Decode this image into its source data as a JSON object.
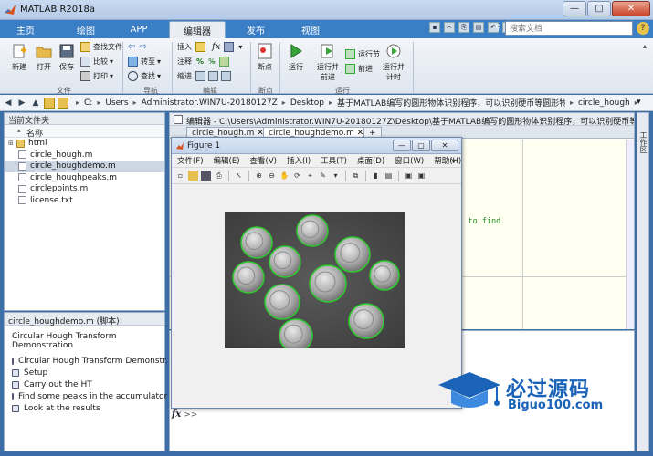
{
  "window": {
    "title": "MATLAB R2018a",
    "buttons": {
      "minimize": "—",
      "maximize": "▢",
      "close": "✕"
    }
  },
  "tabs": [
    {
      "label": "主页"
    },
    {
      "label": "绘图"
    },
    {
      "label": "APP"
    },
    {
      "label": "编辑器",
      "active": true
    },
    {
      "label": "发布"
    },
    {
      "label": "视图"
    }
  ],
  "search": {
    "placeholder": "搜索文档"
  },
  "ribbon": {
    "file": {
      "new": "新建",
      "open": "打开",
      "save": "保存",
      "find_files": "查找文件",
      "compare": "比较",
      "print": "打印",
      "group": "文件"
    },
    "navigate": {
      "goto": "转至",
      "find": "查找",
      "group": "导航"
    },
    "edit": {
      "insert": "插入",
      "comment": "注释",
      "indent": "缩进",
      "fx": "fx",
      "group": "编辑"
    },
    "breakpoints": {
      "breakpoints": "断点",
      "group": "断点"
    },
    "run": {
      "run": "运行",
      "run_advance": "运行并\n前进",
      "run_section": "运行节",
      "advance": "前进",
      "run_time": "运行并\n计时",
      "group": "运行"
    }
  },
  "address": {
    "segments": [
      "C:",
      "Users",
      "Administrator.WIN7U-20180127Z",
      "Desktop",
      "基于MATLAB编写的圆形物体识别程序，可以识别硬币等圆形物体",
      "circle_hough"
    ]
  },
  "current_folder": {
    "title": "当前文件夹",
    "column": "名称",
    "files": [
      {
        "name": "html",
        "type": "folder"
      },
      {
        "name": "circle_hough.m",
        "type": "m"
      },
      {
        "name": "circle_houghdemo.m",
        "type": "m",
        "selected": true
      },
      {
        "name": "circle_houghpeaks.m",
        "type": "m"
      },
      {
        "name": "circlepoints.m",
        "type": "m"
      },
      {
        "name": "license.txt",
        "type": "txt"
      }
    ]
  },
  "details": {
    "title": "circle_houghdemo.m  (脚本)",
    "heading": "Circular Hough Transform Demonstration",
    "cells": [
      "Circular Hough Transform Demonstr...",
      "Setup",
      "Carry out the HT",
      "Find some peaks in the accumulator",
      "Look at the results"
    ]
  },
  "editor": {
    "title": "编辑器 - C:\\Users\\Administrator.WIN7U-20180127Z\\Desktop\\基于MATLAB编写的圆形物体识别程序，可以识别硬币等圆形物...",
    "tabs": [
      {
        "label": "circle_hough.m"
      },
      {
        "label": "circle_houghdemo.m",
        "active": true
      }
    ],
    "tab_add": "+",
    "code_snippet": "ks| to find"
  },
  "command": {
    "fx": "fx",
    "prompt": ">>"
  },
  "workspace": {
    "label": "工作区"
  },
  "figure": {
    "title": "Figure 1",
    "menus": [
      "文件(F)",
      "编辑(E)",
      "查看(V)",
      "插入(I)",
      "工具(T)",
      "桌面(D)",
      "窗口(W)",
      "帮助(H)"
    ],
    "coins": 10
  },
  "watermark": {
    "text": "必过源码",
    "sub": "Biguo100.com"
  },
  "colors": {
    "accent": "#3a7fc6",
    "circle_detect": "#2ecc2e"
  }
}
